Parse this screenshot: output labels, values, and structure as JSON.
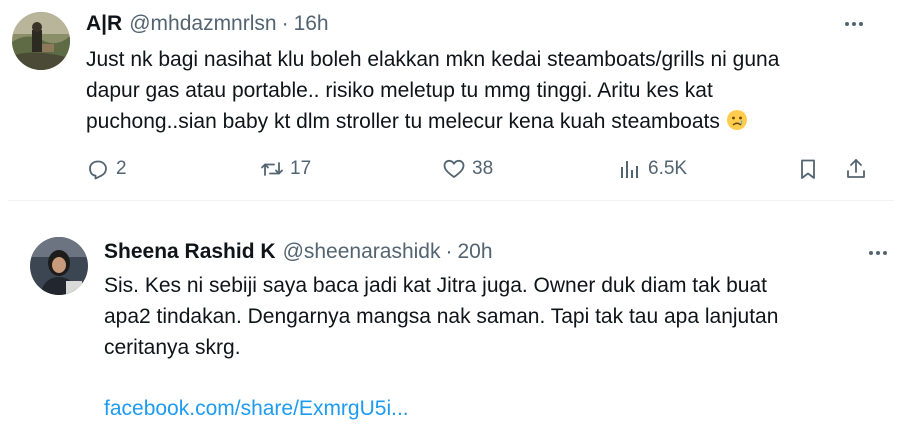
{
  "tweets": [
    {
      "name": "A|R",
      "handle": "@mhdazmnrlsn",
      "separator": "·",
      "time": "16h",
      "lines": [
        "Just nk bagi nasihat klu boleh elakkan mkn kedai steamboats/grills ni guna",
        "dapur gas atau portable.. risiko meletup tu mmg tinggi. Aritu kes kat",
        "puchong..sian baby kt dlm stroller tu melecur kena kuah steamboats"
      ],
      "emoji": "crying-face",
      "stats": {
        "replies": "2",
        "reposts": "17",
        "likes": "38",
        "views": "6.5K"
      }
    },
    {
      "name": "Sheena Rashid K",
      "handle": "@sheenarashidk",
      "separator": "·",
      "time": "20h",
      "lines": [
        "Sis. Kes ni sebiji saya baca jadi kat Jitra juga. Owner duk diam tak buat",
        "apa2 tindakan. Dengarnya mangsa nak saman. Tapi tak tau apa lanjutan",
        "ceritanya skrg."
      ],
      "link": "facebook.com/share/ExmrgU5i..."
    }
  ],
  "colors": {
    "text": "#0f1419",
    "muted": "#536471",
    "link": "#1d9bf0",
    "divider": "#eff3f4"
  },
  "icons": [
    "reply-icon",
    "repost-icon",
    "like-icon",
    "views-icon",
    "bookmark-icon",
    "share-icon",
    "more-icon"
  ]
}
